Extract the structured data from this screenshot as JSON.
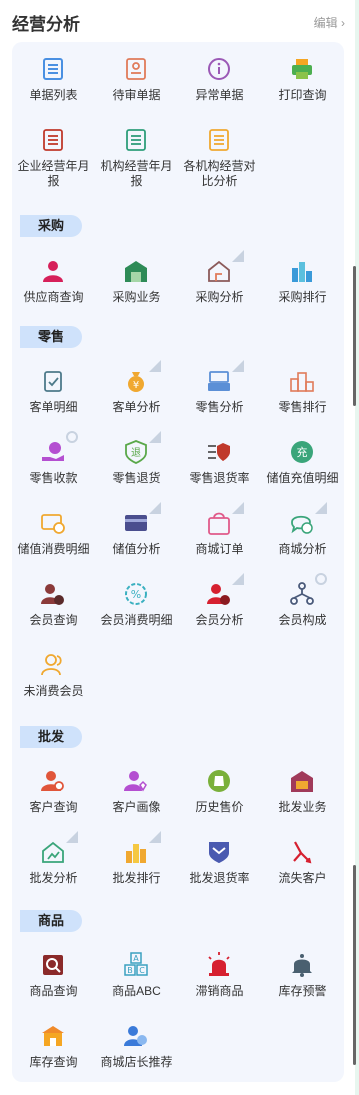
{
  "header": {
    "title": "经营分析",
    "edit": "编辑"
  },
  "top": [
    {
      "label": "单据列表",
      "icon": "document-list-icon",
      "color": "#4a90e2"
    },
    {
      "label": "待审单据",
      "icon": "pending-audit-icon",
      "color": "#e07b5a"
    },
    {
      "label": "异常单据",
      "icon": "info-circle-icon",
      "color": "#9b59b6"
    },
    {
      "label": "打印查询",
      "icon": "printer-icon",
      "color": "#4caf50"
    },
    {
      "label": "企业经营年月报",
      "icon": "report-icon",
      "color": "#c0392b"
    },
    {
      "label": "机构经营年月报",
      "icon": "report-icon",
      "color": "#2e9e7a"
    },
    {
      "label": "各机构经营对比分析",
      "icon": "report-icon",
      "color": "#f0a830"
    }
  ],
  "sections": [
    {
      "tag": "采购",
      "items": [
        {
          "label": "供应商查询",
          "icon": "supplier-icon",
          "color": "#d6205a"
        },
        {
          "label": "采购业务",
          "icon": "warehouse-icon",
          "color": "#2e8b57"
        },
        {
          "label": "采购分析",
          "icon": "house-analysis-icon",
          "color": "#8b5a5a"
        },
        {
          "label": "采购排行",
          "icon": "ranking-bars-icon",
          "color": "#3a9ad9"
        }
      ]
    },
    {
      "tag": "零售",
      "items": [
        {
          "label": "客单明细",
          "icon": "clipboard-check-icon",
          "color": "#4d7a8a"
        },
        {
          "label": "客单分析",
          "icon": "money-bag-icon",
          "color": "#f0a830"
        },
        {
          "label": "零售分析",
          "icon": "register-icon",
          "color": "#5b8fd6"
        },
        {
          "label": "零售排行",
          "icon": "podium-icon",
          "color": "#e07b5a"
        },
        {
          "label": "零售收款",
          "icon": "hand-coin-icon",
          "color": "#b44fd1"
        },
        {
          "label": "零售退货",
          "icon": "return-shield-icon",
          "color": "#5aa84a"
        },
        {
          "label": "零售退货率",
          "icon": "list-shield-icon",
          "color": "#c0392b"
        },
        {
          "label": "储值充值明细",
          "icon": "recharge-icon",
          "color": "#3aa57a"
        },
        {
          "label": "储值消费明细",
          "icon": "card-coin-icon",
          "color": "#f0a830"
        },
        {
          "label": "储值分析",
          "icon": "card-icon",
          "color": "#4a4e8e"
        },
        {
          "label": "商城订单",
          "icon": "shopping-bag-icon",
          "color": "#e05a8a"
        },
        {
          "label": "商城分析",
          "icon": "chat-bubble-icon",
          "color": "#3aa57a"
        },
        {
          "label": "会员查询",
          "icon": "member-search-icon",
          "color": "#8b3a3a"
        },
        {
          "label": "会员消费明细",
          "icon": "percent-gear-icon",
          "color": "#3ab0c0"
        },
        {
          "label": "会员分析",
          "icon": "member-analysis-icon",
          "color": "#d62030"
        },
        {
          "label": "会员构成",
          "icon": "hierarchy-icon",
          "color": "#4a5a7a"
        },
        {
          "label": "未消费会员",
          "icon": "members-outline-icon",
          "color": "#f0a830"
        }
      ]
    },
    {
      "tag": "批发",
      "items": [
        {
          "label": "客户查询",
          "icon": "customer-search-icon",
          "color": "#e0553a"
        },
        {
          "label": "客户画像",
          "icon": "customer-portrait-icon",
          "color": "#b44fd1"
        },
        {
          "label": "历史售价",
          "icon": "price-bag-icon",
          "color": "#7ab03a"
        },
        {
          "label": "批发业务",
          "icon": "truck-icon",
          "color": "#a03a5a"
        },
        {
          "label": "批发分析",
          "icon": "house-chart-icon",
          "color": "#3aa57a"
        },
        {
          "label": "批发排行",
          "icon": "bar-ranking-icon",
          "color": "#f0a830"
        },
        {
          "label": "批发退货率",
          "icon": "chevron-shield-icon",
          "color": "#4a5ab0"
        },
        {
          "label": "流失客户",
          "icon": "split-arrow-icon",
          "color": "#d62030"
        }
      ]
    },
    {
      "tag": "商品",
      "items": [
        {
          "label": "商品查询",
          "icon": "product-search-icon",
          "color": "#8b2a2a"
        },
        {
          "label": "商品ABC",
          "icon": "abc-blocks-icon",
          "color": "#3aa0c0"
        },
        {
          "label": "滞销商品",
          "icon": "alarm-light-icon",
          "color": "#d62030"
        },
        {
          "label": "库存预警",
          "icon": "bell-icon",
          "color": "#4a6070"
        },
        {
          "label": "库存查询",
          "icon": "store-icon",
          "color": "#f08a2a"
        },
        {
          "label": "商城店长推荐",
          "icon": "manager-recommend-icon",
          "color": "#3a7ad9"
        }
      ]
    }
  ]
}
